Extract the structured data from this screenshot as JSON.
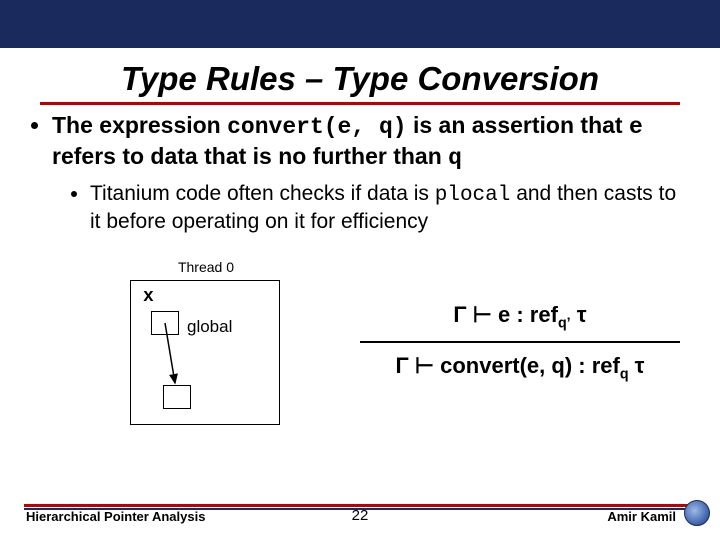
{
  "title": "Type Rules – Type Conversion",
  "bullet1": {
    "pre": "The expression ",
    "code1": "convert(e, q)",
    "mid1": " is an assertion that ",
    "code2": "e",
    "mid2": " refers to data that is no further than ",
    "code3": "q"
  },
  "bullet2": {
    "pre": "Titanium code often checks if data is ",
    "code1": "plocal",
    "post": " and then casts to it before operating on it for efficiency"
  },
  "diagram": {
    "thread_label": "Thread 0",
    "x": "x",
    "global": "global"
  },
  "rule": {
    "premise": "Γ ├ e : refq’ τ",
    "conclusion": "Γ ├ convert(e, q) : refq τ"
  },
  "footer": {
    "left": "Hierarchical Pointer Analysis",
    "center": "22",
    "right": "Amir Kamil"
  }
}
